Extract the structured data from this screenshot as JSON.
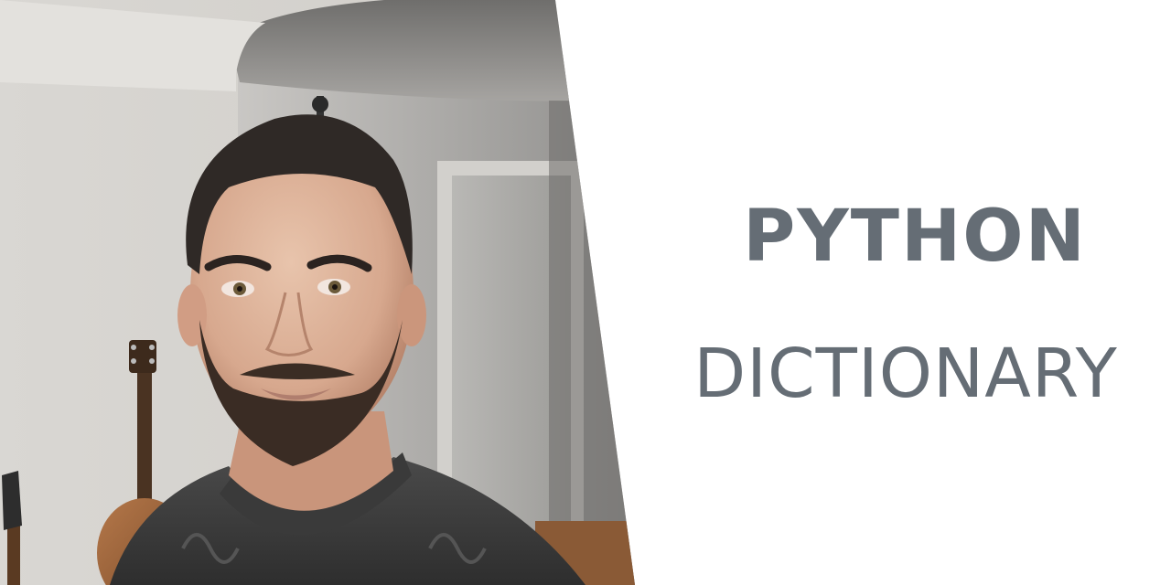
{
  "title": {
    "line1": "PYTHON",
    "line2": "DICTIONARY"
  },
  "colors": {
    "title_text": "#656d75",
    "background": "#ffffff"
  },
  "photo": {
    "subject": "portrait-photo"
  }
}
